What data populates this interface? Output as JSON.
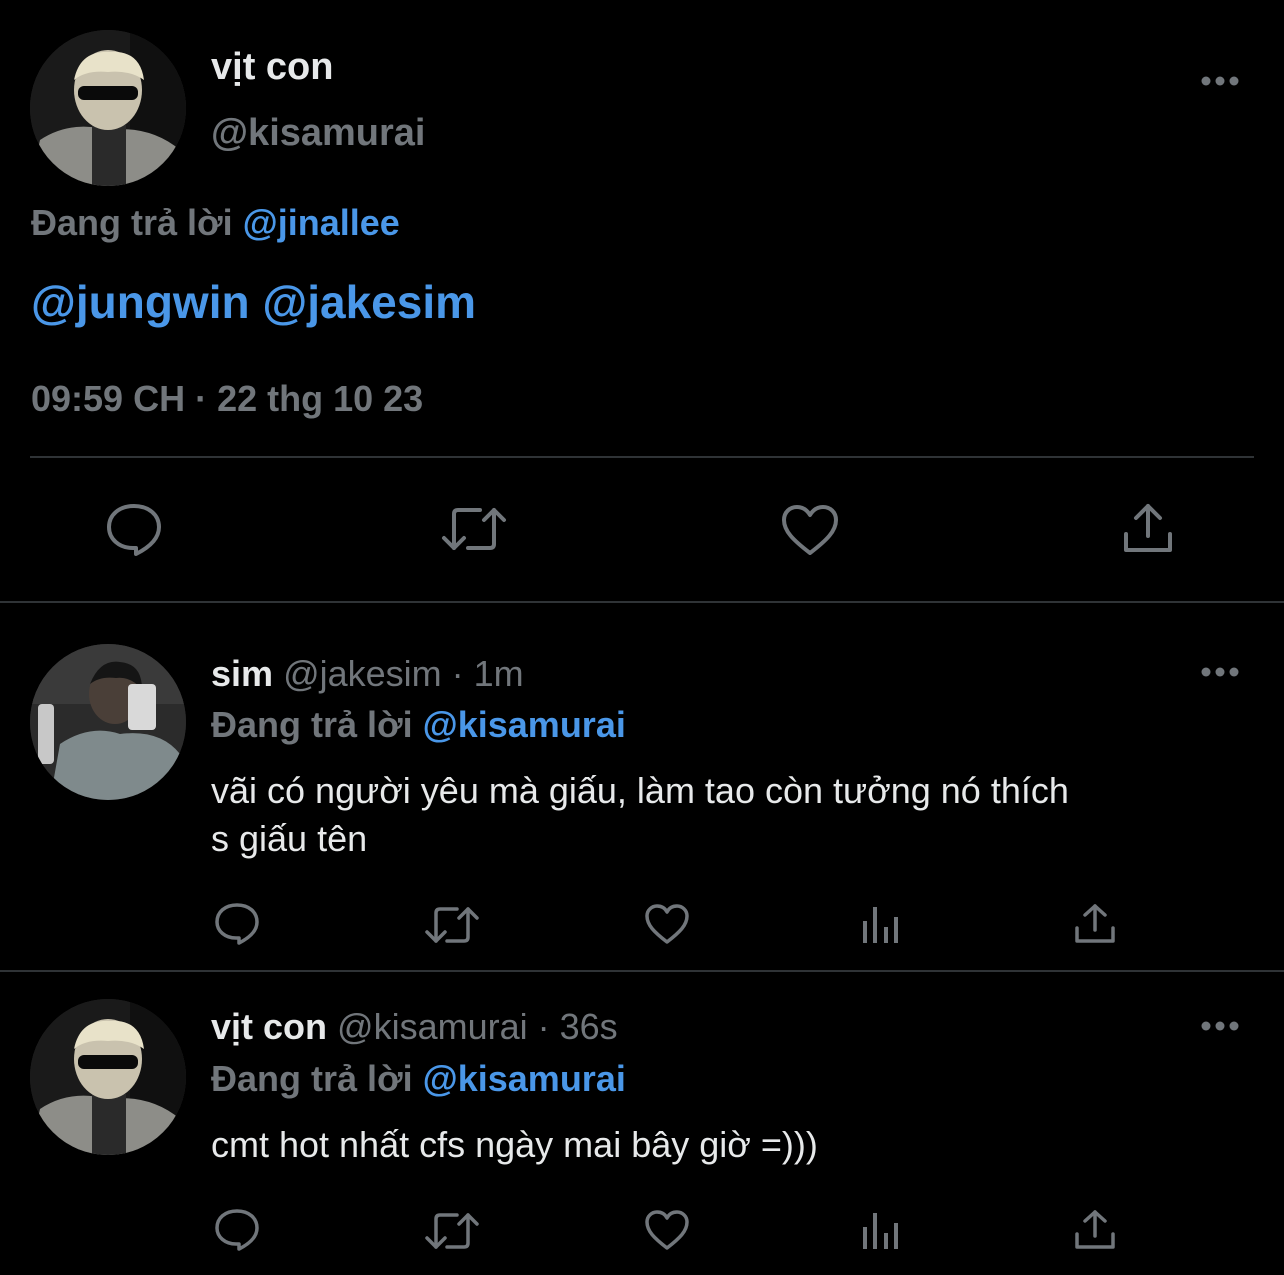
{
  "main_tweet": {
    "display_name": "vịt con",
    "handle": "@kisamurai",
    "replying_prefix": "Đang trả lời",
    "replying_to": "@jinallee",
    "mentions": [
      "@jungwin",
      "@jakesim"
    ],
    "timestamp": "09:59 CH · 22 thg 10 23",
    "icons": [
      "reply-icon",
      "retweet-icon",
      "like-icon",
      "share-icon"
    ]
  },
  "replies": [
    {
      "display_name": "sim",
      "handle": "@jakesim",
      "time": "· 1m",
      "replying_prefix": "Đang trả lời",
      "replying_to": "@kisamurai",
      "text_line1": "vãi có người yêu mà giấu, làm tao còn tưởng nó thích",
      "text_line2": "s giấu tên"
    },
    {
      "display_name": "vịt con",
      "handle": "@kisamurai",
      "time": "· 36s",
      "replying_prefix": "Đang trả lời",
      "replying_to": "@kisamurai",
      "text_line1": "cmt hot nhất cfs ngày mai bây giờ =)))"
    }
  ],
  "colors": {
    "background": "#000000",
    "text": "#e7e9ea",
    "secondary": "#71767b",
    "link": "#4a97e8",
    "divider": "#2f3336"
  }
}
